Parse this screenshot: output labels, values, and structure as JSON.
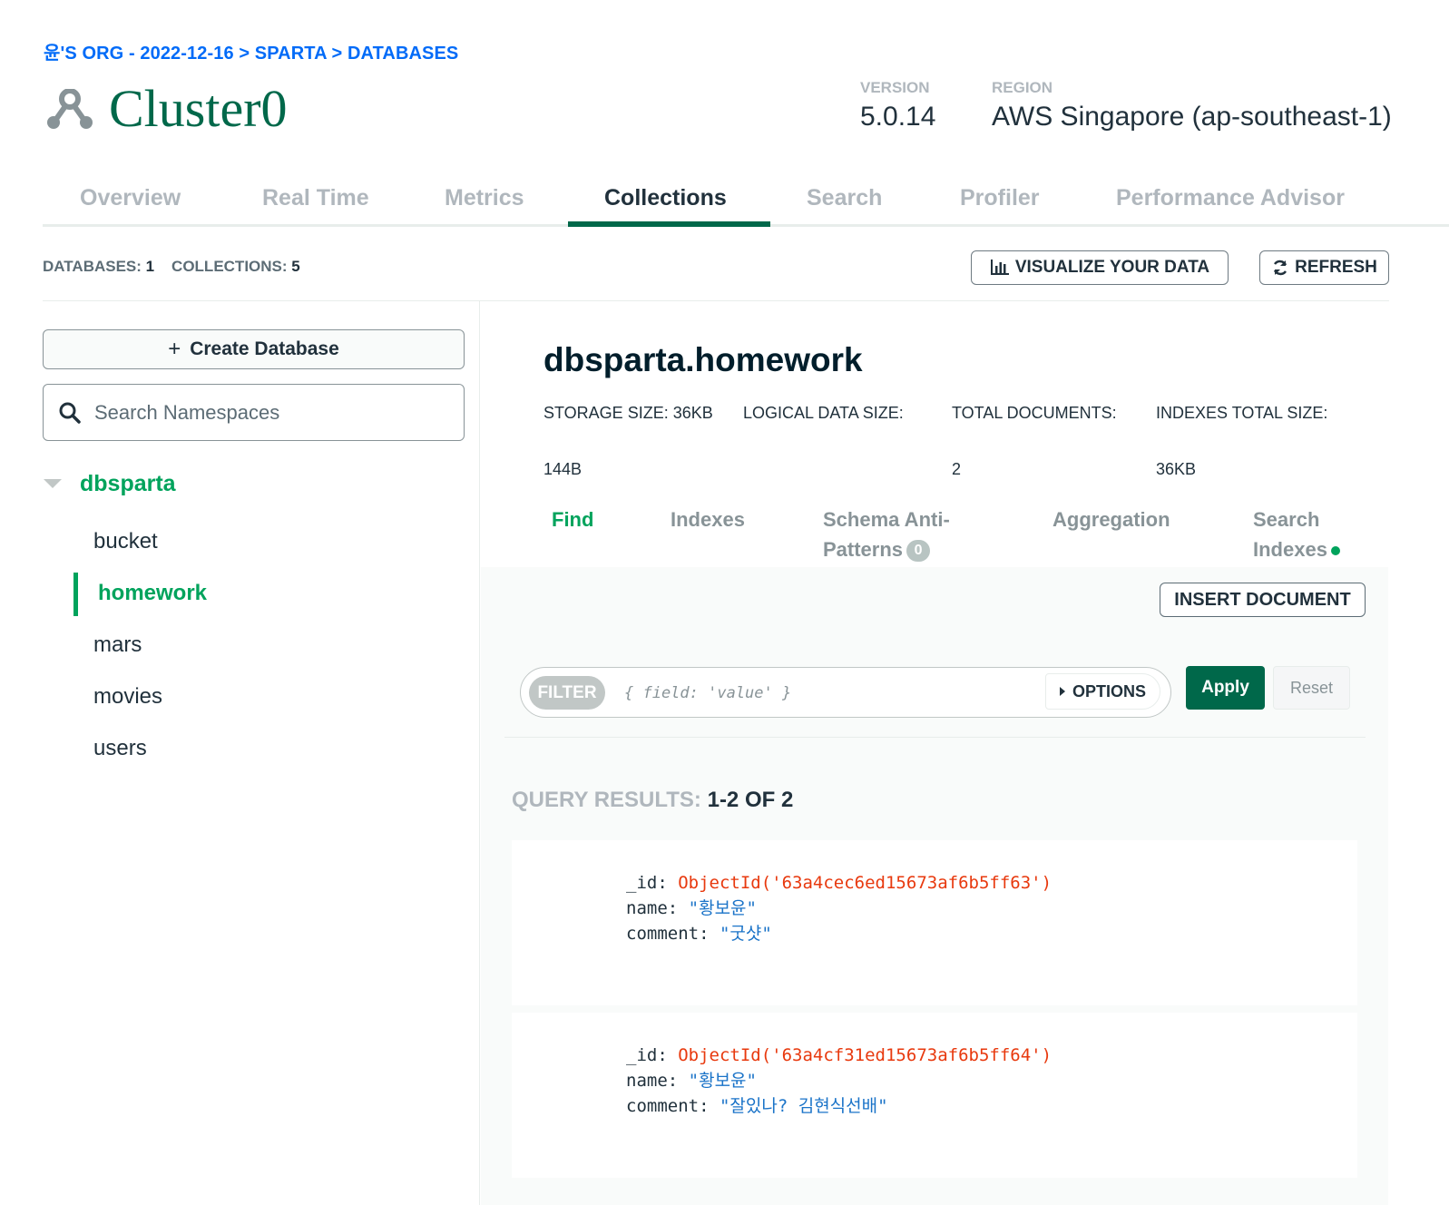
{
  "breadcrumb": "윤'S ORG - 2022-12-16 > SPARTA > DATABASES",
  "cluster": {
    "name": "Cluster0",
    "version_label": "VERSION",
    "version": "5.0.14",
    "region_label": "REGION",
    "region": "AWS Singapore (ap-southeast-1)"
  },
  "tabs": [
    {
      "label": "Overview"
    },
    {
      "label": "Real Time"
    },
    {
      "label": "Metrics"
    },
    {
      "label": "Collections"
    },
    {
      "label": "Search"
    },
    {
      "label": "Profiler"
    },
    {
      "label": "Performance Advisor"
    }
  ],
  "active_tab": "Collections",
  "stats": {
    "databases_label": "DATABASES:",
    "databases": "1",
    "collections_label": "COLLECTIONS:",
    "collections": "5"
  },
  "buttons": {
    "visualize": "VISUALIZE YOUR DATA",
    "refresh": "REFRESH",
    "create_db": "Create Database",
    "insert_document": "INSERT DOCUMENT",
    "apply": "Apply",
    "reset": "Reset",
    "options": "OPTIONS"
  },
  "search": {
    "placeholder": "Search Namespaces"
  },
  "sidebar": {
    "database": "dbsparta",
    "collections": [
      "bucket",
      "homework",
      "mars",
      "movies",
      "users"
    ],
    "active_collection": "homework"
  },
  "namespace": {
    "title": "dbsparta.homework",
    "storage_label": "STORAGE SIZE:",
    "storage_value": "36KB",
    "logical_label": "LOGICAL DATA SIZE:",
    "logical_value": "144B",
    "docs_label": "TOTAL DOCUMENTS:",
    "docs_value": "2",
    "indexes_label": "INDEXES TOTAL SIZE:",
    "indexes_value": "36KB"
  },
  "subtabs": {
    "find": "Find",
    "indexes": "Indexes",
    "schema_line1": "Schema Anti-",
    "schema_line2": "Patterns",
    "schema_badge": "0",
    "aggregation": "Aggregation",
    "search_line1": "Search",
    "search_line2": "Indexes"
  },
  "filter": {
    "tag": "FILTER",
    "placeholder": "{ field: 'value' }"
  },
  "results": {
    "label": "QUERY RESULTS:",
    "value": "1-2 OF 2"
  },
  "documents": [
    {
      "id_key": "_id:",
      "id": "ObjectId('63a4cec6ed15673af6b5ff63')",
      "name_key": "name:",
      "name": "\"황보윤\"",
      "comment_key": "comment:",
      "comment": "\"굿샷\""
    },
    {
      "id_key": "_id:",
      "id": "ObjectId('63a4cf31ed15673af6b5ff64')",
      "name_key": "name:",
      "name": "\"황보윤\"",
      "comment_key": "comment:",
      "comment": "\"잘있나? 김현식선배\""
    }
  ],
  "colors": {
    "brand_green": "#00684a",
    "accent_green": "#00a35c",
    "link_blue": "#016bf8",
    "object_id": "#e8390e",
    "string": "#1a73c8"
  }
}
